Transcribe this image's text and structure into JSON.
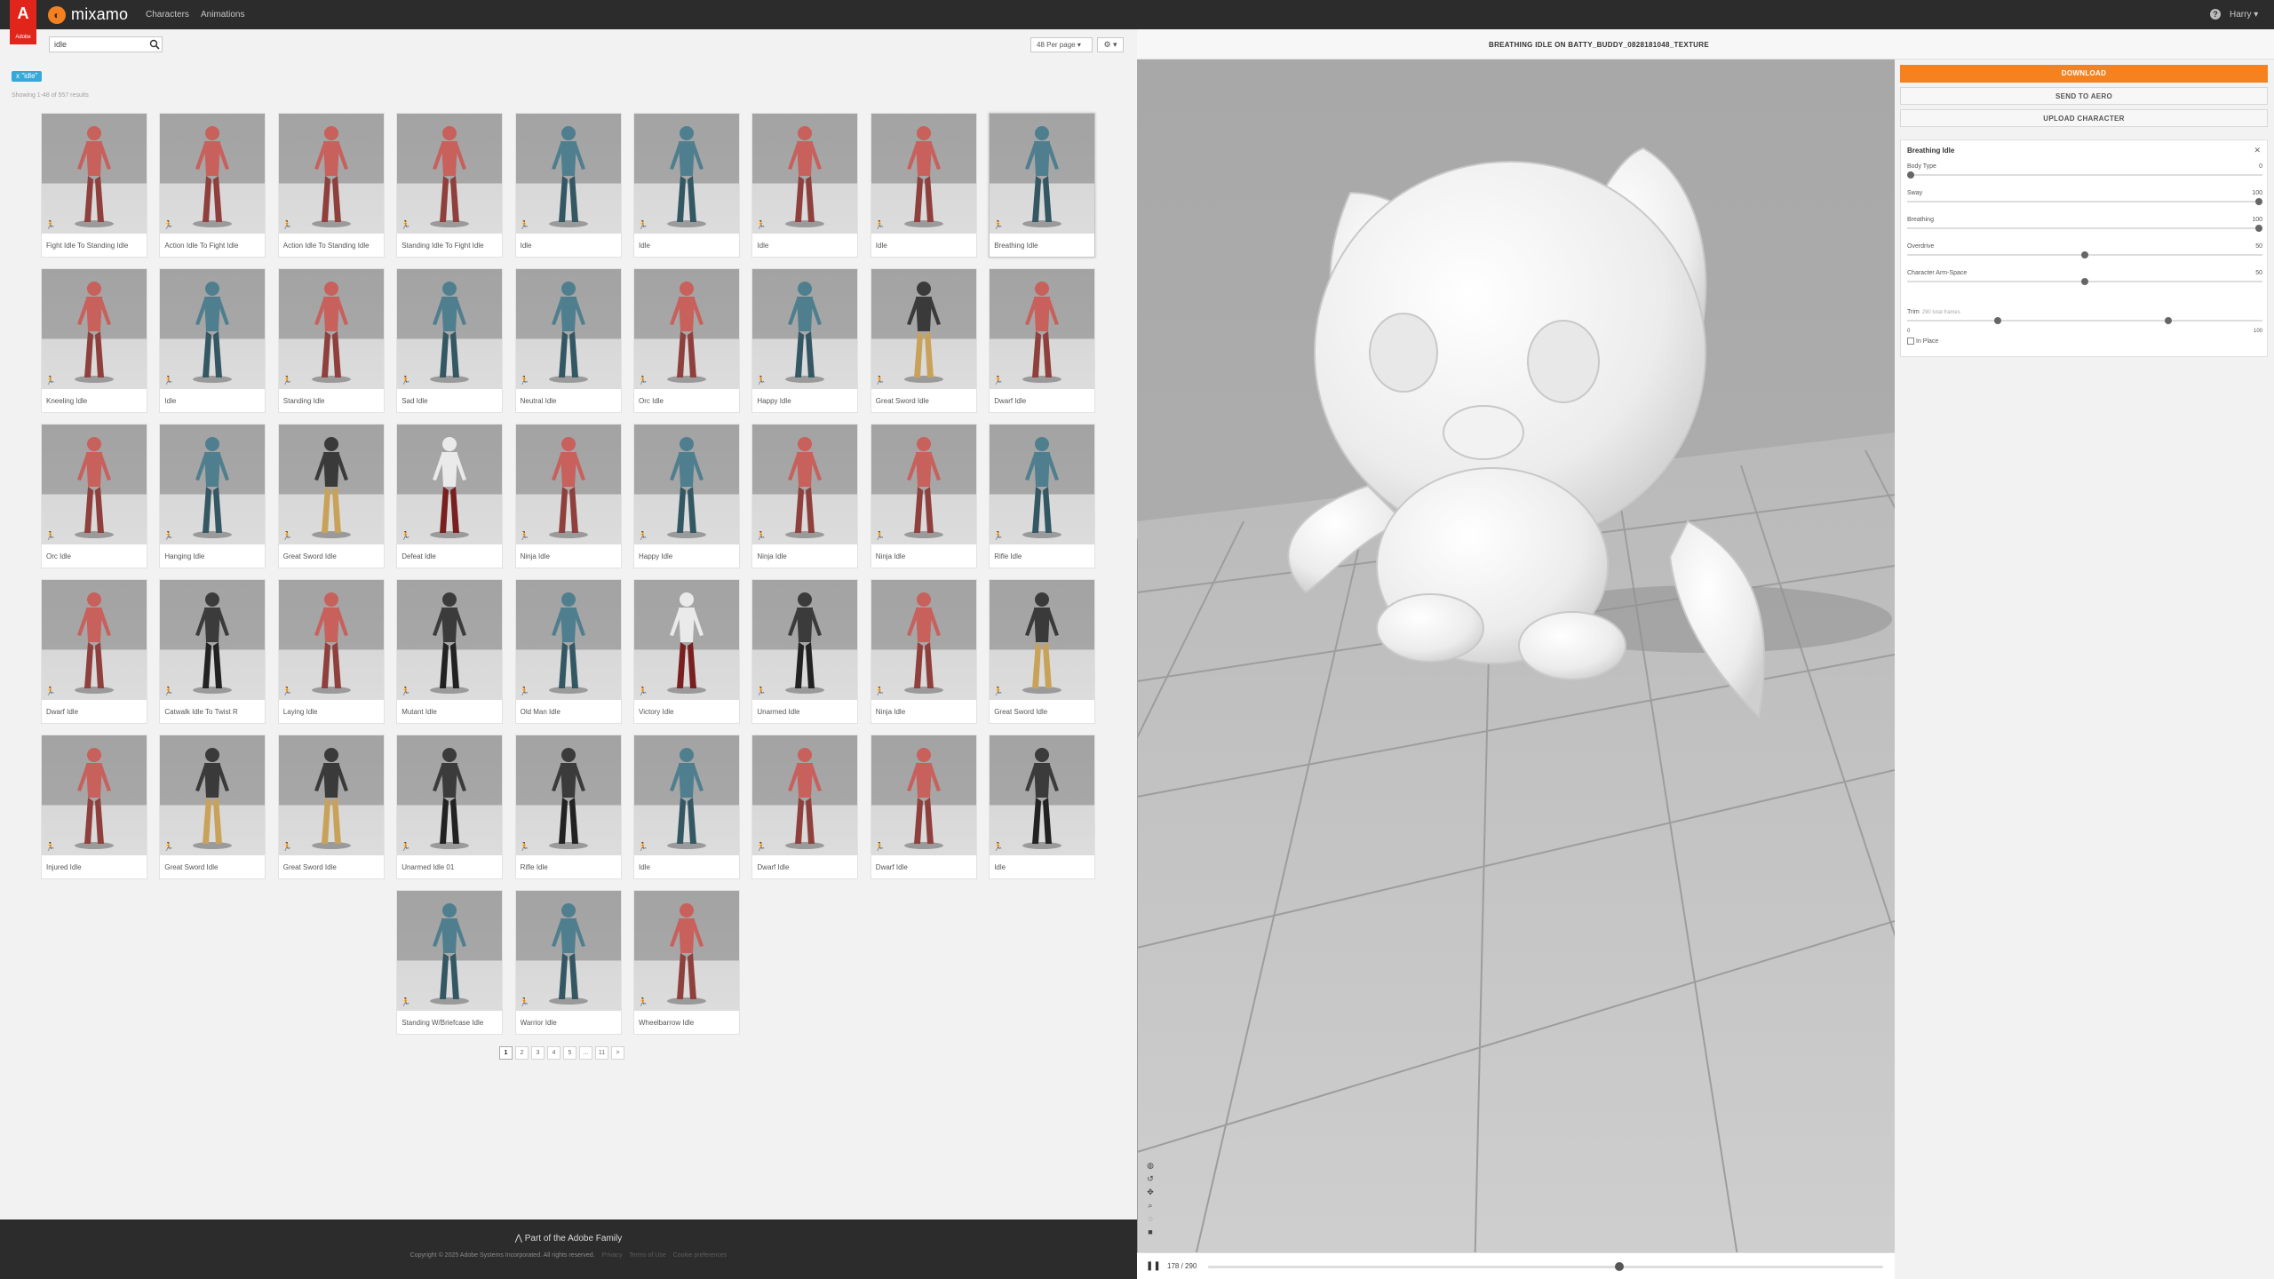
{
  "nav": {
    "adobe_logo": "Adobe",
    "brand": "mixamo",
    "links": [
      "Characters",
      "Animations"
    ],
    "user": "Harry"
  },
  "search": {
    "value": "idle"
  },
  "per_page": "48 Per page",
  "filter_chip": "x \"idle\"",
  "result_count": "Showing 1-48 of 557 results",
  "animations": [
    {
      "label": "Fight Idle To Standing Idle",
      "figure": "female",
      "selected": false
    },
    {
      "label": "Action Idle To Fight Idle",
      "figure": "female",
      "selected": false
    },
    {
      "label": "Action Idle To Standing Idle",
      "figure": "female",
      "selected": false
    },
    {
      "label": "Standing Idle To Fight Idle",
      "figure": "female",
      "selected": false
    },
    {
      "label": "Idle",
      "figure": "male",
      "selected": false
    },
    {
      "label": "Idle",
      "figure": "male",
      "selected": false
    },
    {
      "label": "Idle",
      "figure": "female",
      "selected": false
    },
    {
      "label": "Idle",
      "figure": "female",
      "selected": false
    },
    {
      "label": "Breathing Idle",
      "figure": "male",
      "selected": true
    },
    {
      "label": "Kneeling Idle",
      "figure": "female",
      "selected": false
    },
    {
      "label": "Idle",
      "figure": "male",
      "selected": false
    },
    {
      "label": "Standing Idle",
      "figure": "female",
      "selected": false
    },
    {
      "label": "Sad Idle",
      "figure": "male",
      "selected": false
    },
    {
      "label": "Neutral Idle",
      "figure": "male",
      "selected": false
    },
    {
      "label": "Orc Idle",
      "figure": "female",
      "selected": false
    },
    {
      "label": "Happy Idle",
      "figure": "male",
      "selected": false
    },
    {
      "label": "Great Sword Idle",
      "figure": "warrior",
      "selected": false
    },
    {
      "label": "Dwarf Idle",
      "figure": "female",
      "selected": false
    },
    {
      "label": "Orc Idle",
      "figure": "female",
      "selected": false
    },
    {
      "label": "Hanging Idle",
      "figure": "male",
      "selected": false
    },
    {
      "label": "Great Sword Idle",
      "figure": "warrior",
      "selected": false
    },
    {
      "label": "Defeat Idle",
      "figure": "other",
      "selected": false
    },
    {
      "label": "Ninja Idle",
      "figure": "female",
      "selected": false
    },
    {
      "label": "Happy Idle",
      "figure": "male",
      "selected": false
    },
    {
      "label": "Ninja Idle",
      "figure": "female",
      "selected": false
    },
    {
      "label": "Ninja Idle",
      "figure": "female",
      "selected": false
    },
    {
      "label": "Rifle Idle",
      "figure": "male",
      "selected": false
    },
    {
      "label": "Dwarf Idle",
      "figure": "female",
      "selected": false
    },
    {
      "label": "Catwalk Idle To Twist R",
      "figure": "dark",
      "selected": false
    },
    {
      "label": "Laying Idle",
      "figure": "female",
      "selected": false
    },
    {
      "label": "Mutant Idle",
      "figure": "dark",
      "selected": false
    },
    {
      "label": "Old Man Idle",
      "figure": "male",
      "selected": false
    },
    {
      "label": "Victory Idle",
      "figure": "other",
      "selected": false
    },
    {
      "label": "Unarmed Idle",
      "figure": "dark",
      "selected": false
    },
    {
      "label": "Ninja Idle",
      "figure": "female",
      "selected": false
    },
    {
      "label": "Great Sword Idle",
      "figure": "warrior",
      "selected": false
    },
    {
      "label": "Injured Idle",
      "figure": "female",
      "selected": false
    },
    {
      "label": "Great Sword Idle",
      "figure": "warrior",
      "selected": false
    },
    {
      "label": "Great Sword Idle",
      "figure": "warrior",
      "selected": false
    },
    {
      "label": "Unarmed Idle 01",
      "figure": "dark",
      "selected": false
    },
    {
      "label": "Rifle Idle",
      "figure": "dark",
      "selected": false
    },
    {
      "label": "Idle",
      "figure": "male",
      "selected": false
    },
    {
      "label": "Dwarf Idle",
      "figure": "female",
      "selected": false
    },
    {
      "label": "Dwarf Idle",
      "figure": "female",
      "selected": false
    },
    {
      "label": "Idle",
      "figure": "dark",
      "selected": false
    },
    {
      "label": "Standing W/Briefcase Idle",
      "figure": "male",
      "selected": false
    },
    {
      "label": "Warrior Idle",
      "figure": "male",
      "selected": false
    },
    {
      "label": "Wheelbarrow Idle",
      "figure": "female",
      "selected": false
    }
  ],
  "pagination": [
    "1",
    "2",
    "3",
    "4",
    "5",
    "...",
    "11",
    ">"
  ],
  "footer": {
    "family": "Part of the Adobe Family",
    "copyright": "Copyright © 2025 Adobe Systems Incorporated. All rights reserved.",
    "links": [
      "Privacy",
      "Terms of Use",
      "Cookie preferences"
    ]
  },
  "viewer": {
    "title": "BREATHING IDLE ON BATTY_BUDDY_0828181048_TEXTURE",
    "frame_counter": "178 / 290",
    "playback_fraction": 0.61
  },
  "actions": {
    "download": "DOWNLOAD",
    "send_to_aero": "SEND TO AERO",
    "upload_character": "UPLOAD CHARACTER"
  },
  "settings": {
    "title": "Breathing Idle",
    "params": [
      {
        "label": "Body Type",
        "value": "0",
        "fraction": 0.0
      },
      {
        "label": "Sway",
        "value": "100",
        "fraction": 1.0
      },
      {
        "label": "Breathing",
        "value": "100",
        "fraction": 1.0
      },
      {
        "label": "Overdrive",
        "value": "50",
        "fraction": 0.5
      },
      {
        "label": "Character Arm-Space",
        "value": "50",
        "fraction": 0.5
      }
    ],
    "trim": {
      "label": "Trim",
      "sub": "290 total frames",
      "min": "0",
      "max": "100",
      "low_fraction": 0.25,
      "high_fraction": 0.74
    },
    "in_place": "In Place"
  },
  "colors": {
    "accent": "#f5821f",
    "adobe_red": "#e1251b",
    "chip": "#36a9d9",
    "female_figure": "#c8605c",
    "male_figure": "#4f7f8e"
  }
}
